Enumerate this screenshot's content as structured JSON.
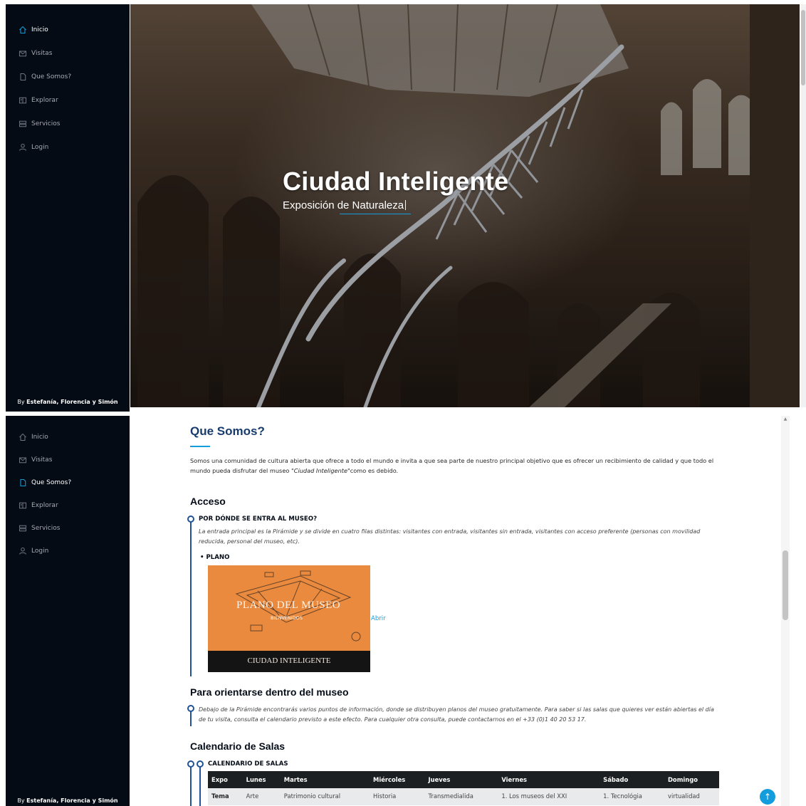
{
  "nav": [
    {
      "label": "Inicio",
      "icon": "home-icon"
    },
    {
      "label": "Visitas",
      "icon": "envelope-icon"
    },
    {
      "label": "Que Somos?",
      "icon": "file-icon"
    },
    {
      "label": "Explorar",
      "icon": "book-icon"
    },
    {
      "label": "Servicios",
      "icon": "server-icon"
    },
    {
      "label": "Login",
      "icon": "person-icon"
    }
  ],
  "top_active": "Inicio",
  "bottom_active": "Que Somos?",
  "byline": {
    "prefix": "By ",
    "names": "Estefanía, Florencia y Simón"
  },
  "hero": {
    "title": "Ciudad Inteligente",
    "subtitle": "Exposición de Naturaleza"
  },
  "section": {
    "title": "Que Somos?",
    "intro_before": "Somos una comunidad de cultura abierta que ofrece a todo el mundo e invita a que sea parte de nuestro principal objetivo que es ofrecer un recibimiento de calidad y que todo el mundo pueda disfrutar del museo ",
    "intro_italic": "\"Ciudad Inteligente\"",
    "intro_after": "como es debido."
  },
  "acceso": {
    "heading": "Acceso",
    "item_title": "POR DÓNDE SE ENTRA AL MUSEO?",
    "item_text": "La entrada principal es la Pirámide y se divide en cuatro filas distintas: visitantes con entrada, visitantes sin entrada, visitantes con acceso preferente (personas con movilidad reducida, personal del museo, etc).",
    "bullet": "PLANO",
    "plano": {
      "title": "PLANO DEL MUSEO",
      "subtitle": "BIENVENIDOS",
      "band": "CIUDAD INTELIGENTE",
      "link": "Abrir"
    }
  },
  "orientarse": {
    "heading": "Para orientarse dentro del museo",
    "text": "Debajo de la Pirámide encontrarás varios puntos de información, donde se distribuyen planos del museo gratuitamente. Para saber si las salas que quieres ver están abiertas el día de tu visita, consulta el calendario previsto a este efecto. Para cualquier otra consulta, puede contactarnos en el +33 (0)1 40 20 53 17."
  },
  "calendario": {
    "heading": "Calendario de Salas",
    "item_title": "CALENDARIO DE SALAS",
    "columns": [
      "Expo",
      "Lunes",
      "Martes",
      "Miércoles",
      "Jueves",
      "Viernes",
      "Sábado",
      "Domingo"
    ],
    "rows": [
      [
        "Tema",
        "Arte",
        "Patrimonio cultural",
        "Historia",
        "Transmedialida",
        "1. Los museos del XXI",
        "1. Tecnológia",
        "virtualidad"
      ]
    ]
  },
  "colors": {
    "sidebar_bg": "#040b14",
    "accent": "#149ddd",
    "heading": "#173b6c"
  }
}
